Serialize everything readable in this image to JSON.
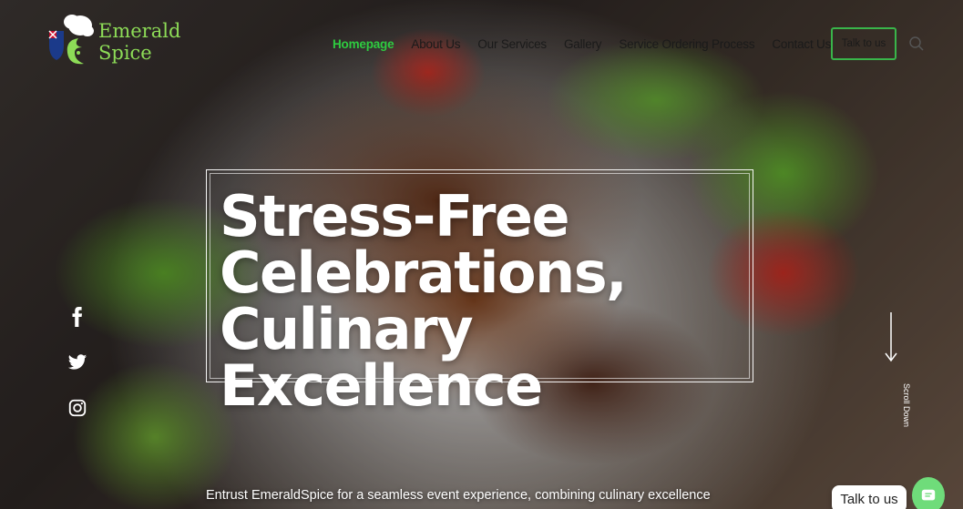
{
  "brand": {
    "name_line1": "Emerald",
    "name_line2": "Spice",
    "accent_color": "#8ddc57"
  },
  "nav": {
    "items": [
      {
        "label": "Homepage",
        "active": true
      },
      {
        "label": "About Us",
        "active": false
      },
      {
        "label": "Our Services",
        "active": false
      },
      {
        "label": "Gallery",
        "active": false
      },
      {
        "label": "Service Ordering Process",
        "active": false
      },
      {
        "label": "Contact Us",
        "active": false
      }
    ],
    "cta_label": "Talk to us",
    "active_color": "#2ecc40"
  },
  "hero": {
    "headline_line1": "Stress-Free",
    "headline_line2": "Celebrations,",
    "headline_line3": "Culinary Excellence",
    "subtext": "Entrust EmeraldSpice for a seamless event experience, combining culinary excellence",
    "scroll_label": "Scroll Down"
  },
  "social": {
    "icons": [
      "facebook-icon",
      "twitter-icon",
      "instagram-icon"
    ]
  },
  "chat": {
    "label": "Talk to us",
    "color": "#6fdc7a"
  }
}
